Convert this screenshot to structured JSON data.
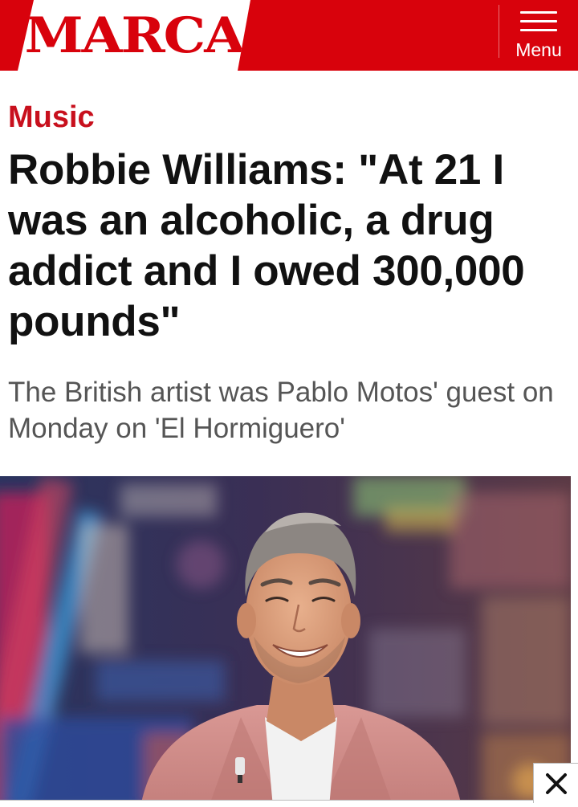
{
  "header": {
    "logo_text": "MARCA",
    "menu_label": "Menu",
    "brand_color": "#d8020c"
  },
  "article": {
    "section": "Music",
    "headline": "Robbie Williams: \"At 21 I was an alcoholic, a drug addict and I owed 300,000 pounds\"",
    "standfirst": "The British artist was Pablo Motos' guest on Monday on 'El Hormiguero'"
  },
  "icons": {
    "menu": "hamburger-icon",
    "close": "close-icon"
  }
}
